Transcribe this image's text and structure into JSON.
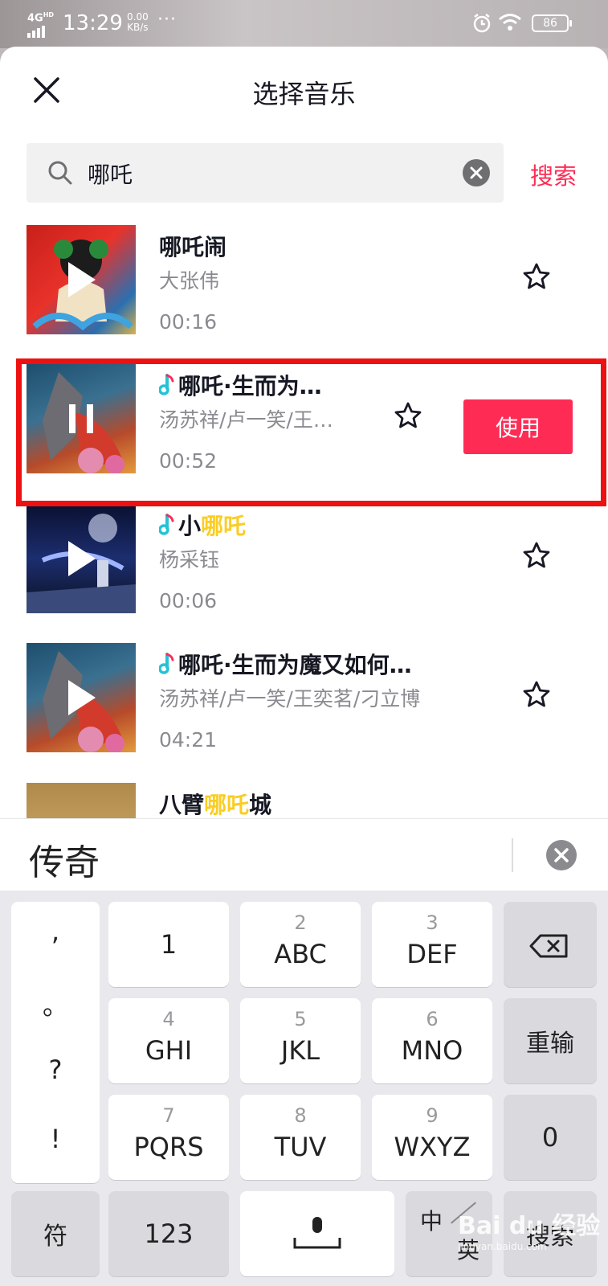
{
  "status_bar": {
    "network": "4G",
    "network_tag": "HD",
    "time": "13:29",
    "speed_value": "0.00",
    "speed_unit": "KB/s",
    "more": "···",
    "battery": "86"
  },
  "header": {
    "title": "选择音乐",
    "close_icon": "close-icon"
  },
  "search": {
    "query": "哪吒",
    "submit_label": "搜索"
  },
  "songs": [
    {
      "title": "哪吒闹",
      "artist": "大张伟",
      "duration": "00:16",
      "playing": false,
      "has_note": false
    },
    {
      "title": "哪吒·生而为…",
      "artist": "汤苏祥/卢一笑/王…",
      "duration": "00:52",
      "playing": true,
      "has_note": true,
      "use_label": "使用"
    },
    {
      "title_prefix": "小",
      "title_highlight": "哪吒",
      "artist": "杨采钰",
      "duration": "00:06",
      "playing": false,
      "has_note": true
    },
    {
      "title": "哪吒·生而为魔又如何…",
      "artist": "汤苏祥/卢一笑/王奕茗/刁立博",
      "duration": "04:21",
      "playing": false,
      "has_note": true
    },
    {
      "title_prefix": "八臂",
      "title_highlight": "哪吒",
      "title_suffix": "城"
    }
  ],
  "ime": {
    "candidate": "传奇",
    "punct": [
      ",",
      "。",
      "?",
      "!"
    ],
    "keys": {
      "k1": {
        "num": "",
        "let": "1"
      },
      "k2": {
        "num": "2",
        "let": "ABC"
      },
      "k3": {
        "num": "3",
        "let": "DEF"
      },
      "k4": {
        "num": "4",
        "let": "GHI"
      },
      "k5": {
        "num": "5",
        "let": "JKL"
      },
      "k6": {
        "num": "6",
        "let": "MNO"
      },
      "k7": {
        "num": "7",
        "let": "PQRS"
      },
      "k8": {
        "num": "8",
        "let": "TUV"
      },
      "k9": {
        "num": "9",
        "let": "WXYZ"
      }
    },
    "reinput": "重输",
    "zero": "0",
    "symbol": "符",
    "numeric": "123",
    "lang_zh": "中",
    "lang_en": "英",
    "search": "搜索"
  },
  "watermark": {
    "brand": "Bai du 经验",
    "site": "jingyan.baidu.com"
  },
  "colors": {
    "accent": "#fe2c55",
    "highlight": "#facd22",
    "note": "#25c2d7",
    "frame": "#ee1111"
  }
}
